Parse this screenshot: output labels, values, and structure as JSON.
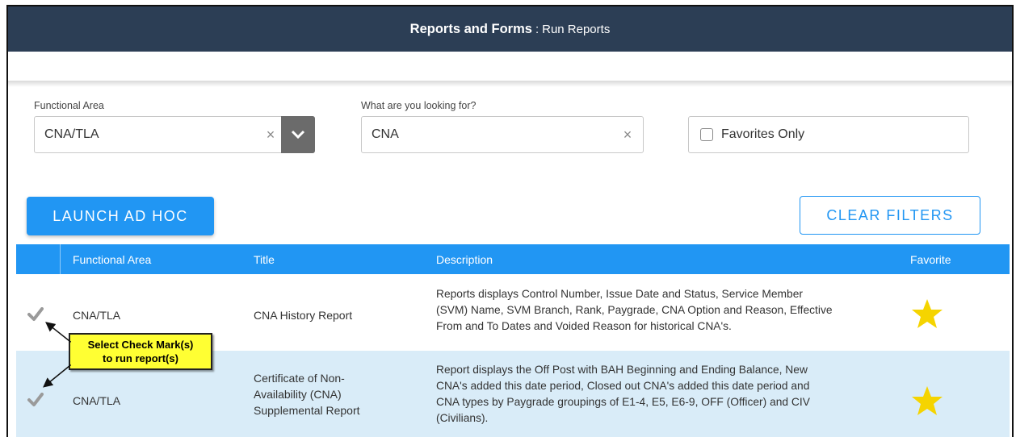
{
  "header": {
    "title": "Reports and Forms",
    "separator": ":",
    "subtitle": "Run Reports"
  },
  "filters": {
    "functional_area_label": "Functional Area",
    "functional_area_value": "CNA/TLA",
    "search_label": "What are you looking for?",
    "search_value": "CNA",
    "favorites_label": "Favorites Only",
    "favorites_checked": false
  },
  "buttons": {
    "launch": "LAUNCH AD HOC",
    "clear": "CLEAR FILTERS"
  },
  "table": {
    "headers": [
      "Functional Area",
      "Title",
      "Description",
      "Favorite"
    ],
    "rows": [
      {
        "functional_area": "CNA/TLA",
        "title": [
          "CNA History Report"
        ],
        "description": [
          "Reports displays Control Number, Issue Date and Status, Service Member",
          "(SVM) Name, SVM Branch, Rank, Paygrade, CNA Option and Reason, Effective",
          "From and To Dates and Voided Reason for historical CNA's."
        ],
        "favorite": true
      },
      {
        "functional_area": "CNA/TLA",
        "title": [
          "Certificate of Non-",
          "Availability (CNA)",
          "Supplemental Report"
        ],
        "description": [
          "Report displays the Off Post with BAH Beginning and Ending Balance, New",
          "CNA's added this date period, Closed out CNA's added this date period and",
          "CNA types by Paygrade groupings of E1-4, E5, E6-9, OFF (Officer) and CIV",
          "(Civilians)."
        ],
        "favorite": true
      }
    ]
  },
  "callout": {
    "line1": "Select Check Mark(s)",
    "line2": "to run report(s)"
  },
  "colors": {
    "header_bg": "#2c3e55",
    "accent": "#2196f3",
    "row_highlight": "#d9ecf8",
    "star": "#f5d400",
    "callout_bg": "#ffff33"
  }
}
